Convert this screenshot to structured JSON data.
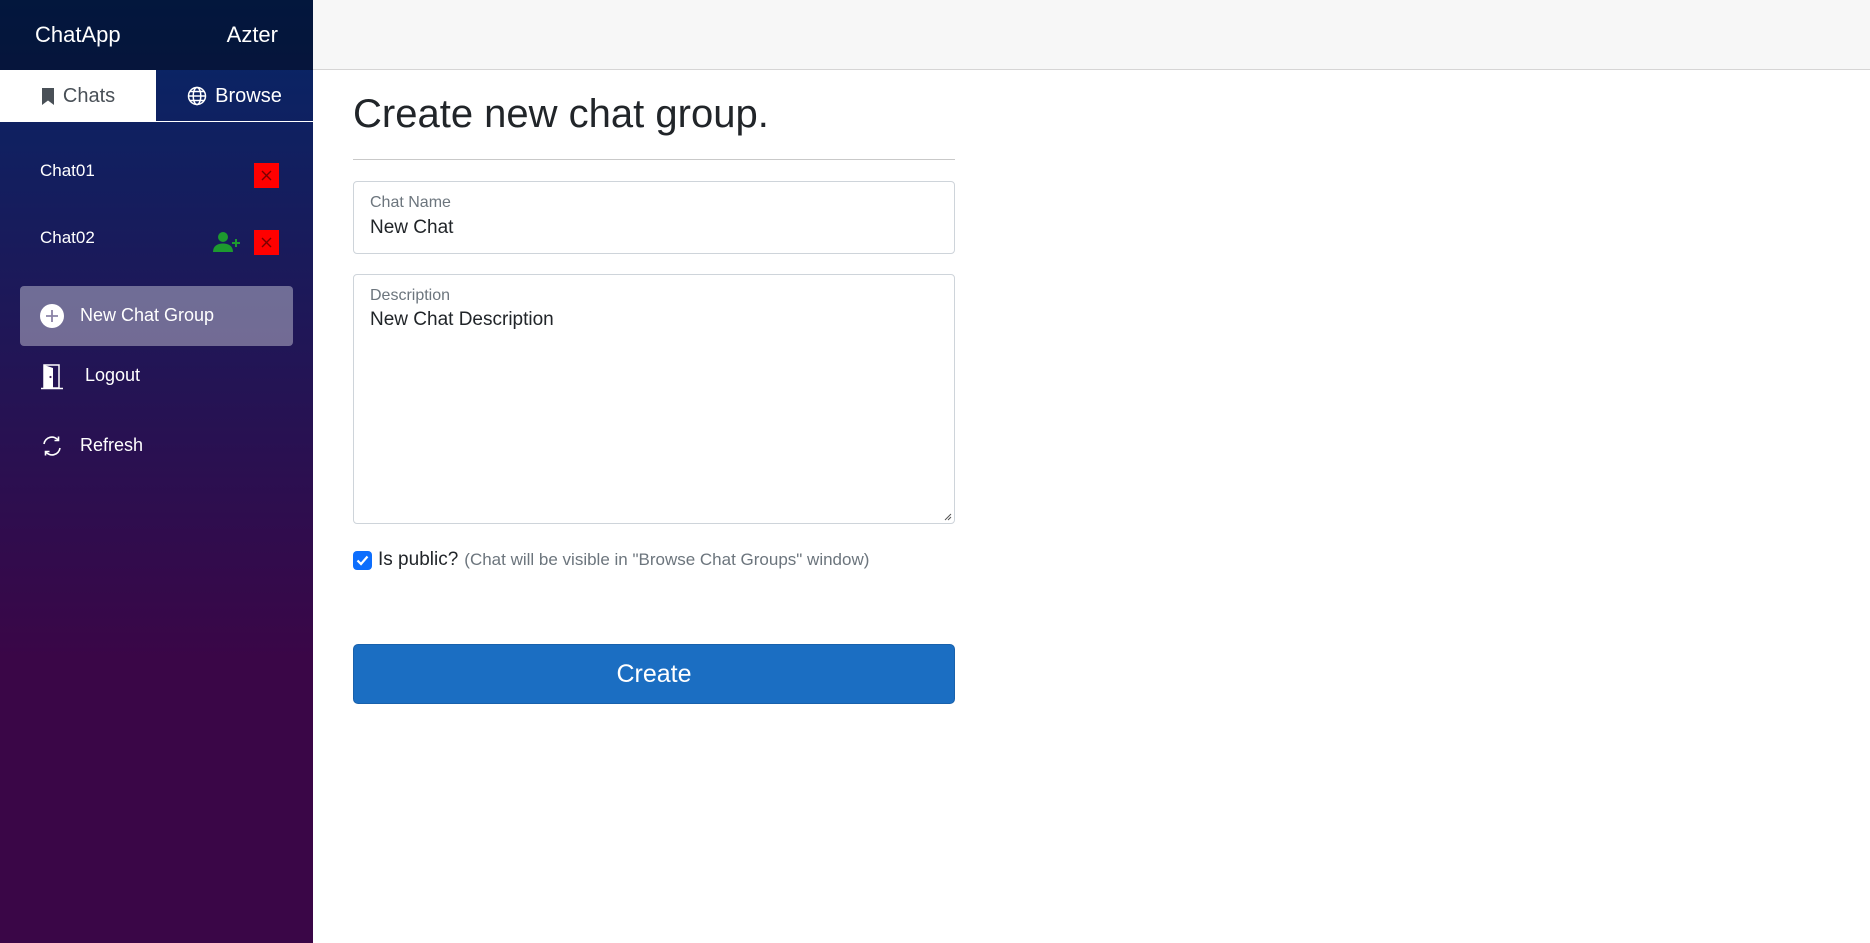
{
  "app": {
    "brand": "ChatApp",
    "user": "Azter"
  },
  "tabs": {
    "chats": "Chats",
    "browse": "Browse"
  },
  "chats": [
    {
      "name": "Chat01",
      "can_add_user": false
    },
    {
      "name": "Chat02",
      "can_add_user": true
    }
  ],
  "nav": {
    "new_chat_group": "New Chat Group",
    "logout": "Logout",
    "refresh": "Refresh"
  },
  "form": {
    "title": "Create new chat group.",
    "chat_name_label": "Chat Name",
    "chat_name_value": "New Chat",
    "description_label": "Description",
    "description_value": "New Chat Description",
    "is_public_label": "Is public?",
    "is_public_note": "(Chat will be visible in \"Browse Chat Groups\" window)",
    "is_public_checked": true,
    "create_label": "Create"
  },
  "colors": {
    "sidebar_top": "#052767",
    "sidebar_bottom": "#3a0647",
    "delete_red": "#ff0000",
    "add_user_green": "#1d9a2f",
    "primary_blue": "#1b6ec2",
    "checkbox_blue": "#0d6efd"
  }
}
